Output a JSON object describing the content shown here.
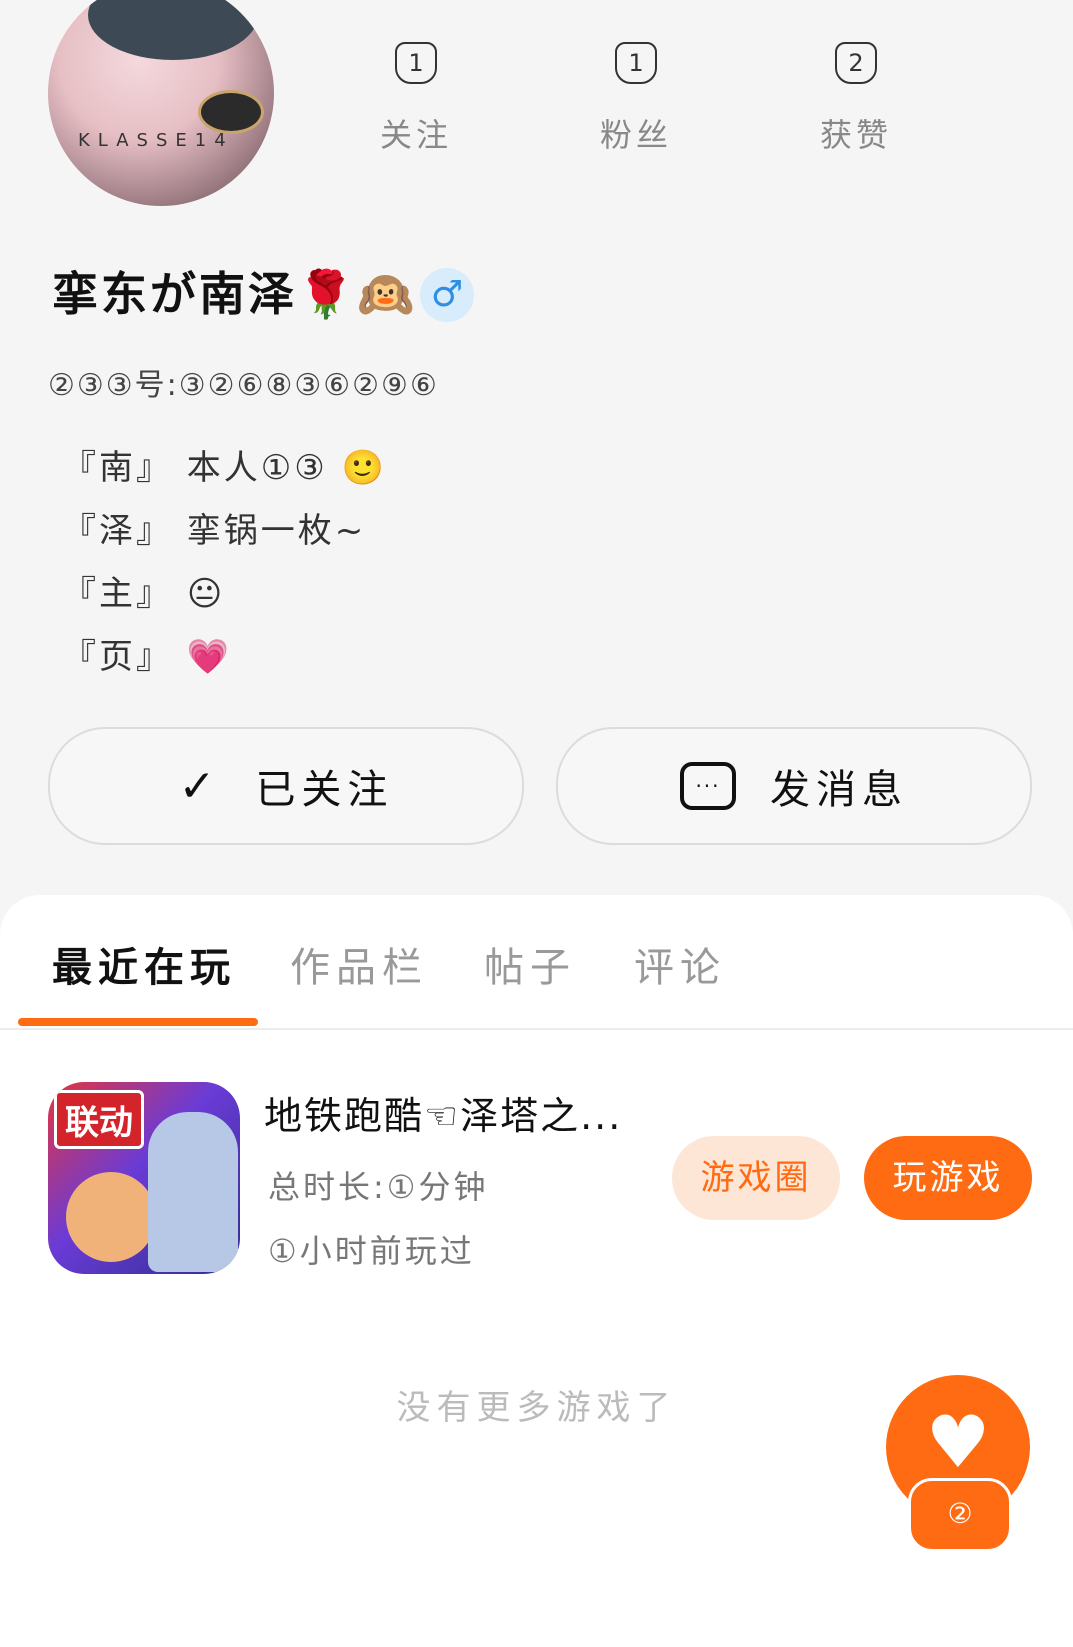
{
  "profile": {
    "avatar_brand": "KLASSE14",
    "name": "挛东が南泽",
    "name_emoji_1": "🌹",
    "name_emoji_2": "🙉",
    "gender_symbol": "♂",
    "uid": "②③③号:③②⑥⑧③⑥②⑨⑥"
  },
  "stats": [
    {
      "num": "1",
      "label": "关注"
    },
    {
      "num": "1",
      "label": "粉丝"
    },
    {
      "num": "2",
      "label": "获赞"
    }
  ],
  "bio": [
    {
      "text": "『南』 本人①③",
      "emoji": "🙂"
    },
    {
      "text": "『泽』 挛锅一枚~",
      "emoji": ""
    },
    {
      "text": "『主』",
      "emoji": "😐"
    },
    {
      "text": "『页』",
      "emoji": "💗"
    }
  ],
  "actions": {
    "follow_icon": "✓",
    "follow_label": "已关注",
    "message_icon": "···",
    "message_label": "发消息"
  },
  "tabs": [
    {
      "label": "最近在玩",
      "active": true
    },
    {
      "label": "作品栏",
      "active": false
    },
    {
      "label": "帖子",
      "active": false
    },
    {
      "label": "评论",
      "active": false
    }
  ],
  "game": {
    "badge": "联动",
    "title": "地铁跑酷☜泽塔之...",
    "total_time": "总时长:①分钟",
    "last_played": "①小时前玩过",
    "circle_button": "游戏圈",
    "play_button": "玩游戏"
  },
  "footer": {
    "no_more": "没有更多游戏了"
  },
  "fab": {
    "heart": "♥",
    "count": "②"
  },
  "colors": {
    "accent": "#ff6b12",
    "accent_light": "#fde6d5",
    "background": "#f5f5f5",
    "gender_blue": "#2d8fe4"
  }
}
